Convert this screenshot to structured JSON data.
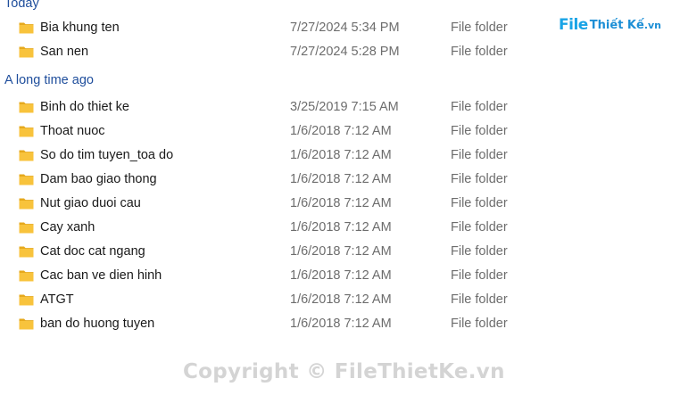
{
  "groups": [
    {
      "header": "Today",
      "items": [
        {
          "name": "Bia khung ten",
          "date": "7/27/2024 5:34 PM",
          "type": "File folder"
        },
        {
          "name": "San nen",
          "date": "7/27/2024 5:28 PM",
          "type": "File folder"
        }
      ]
    },
    {
      "header": "A long time ago",
      "items": [
        {
          "name": "Binh do thiet ke",
          "date": "3/25/2019 7:15 AM",
          "type": "File folder"
        },
        {
          "name": "Thoat nuoc",
          "date": "1/6/2018 7:12 AM",
          "type": "File folder"
        },
        {
          "name": "So do tim tuyen_toa do",
          "date": "1/6/2018 7:12 AM",
          "type": "File folder"
        },
        {
          "name": "Dam bao giao thong",
          "date": "1/6/2018 7:12 AM",
          "type": "File folder"
        },
        {
          "name": "Nut giao duoi cau",
          "date": "1/6/2018 7:12 AM",
          "type": "File folder"
        },
        {
          "name": "Cay xanh",
          "date": "1/6/2018 7:12 AM",
          "type": "File folder"
        },
        {
          "name": "Cat doc cat ngang",
          "date": "1/6/2018 7:12 AM",
          "type": "File folder"
        },
        {
          "name": "Cac ban ve dien hinh",
          "date": "1/6/2018 7:12 AM",
          "type": "File folder"
        },
        {
          "name": "ATGT",
          "date": "1/6/2018 7:12 AM",
          "type": "File folder"
        },
        {
          "name": "ban do huong tuyen",
          "date": "1/6/2018 7:12 AM",
          "type": "File folder"
        }
      ]
    }
  ],
  "logo": {
    "file": "File",
    "rest": "Thiết Kế",
    "tld": ".vn"
  },
  "watermark": "Copyright © FileThietKe.vn",
  "icons": {
    "folder": "folder-icon"
  },
  "colors": {
    "header": "#1f4e9c",
    "folder": "#f8c33c",
    "folder_back": "#e6a91d",
    "muted_text": "#6d6d6d"
  }
}
